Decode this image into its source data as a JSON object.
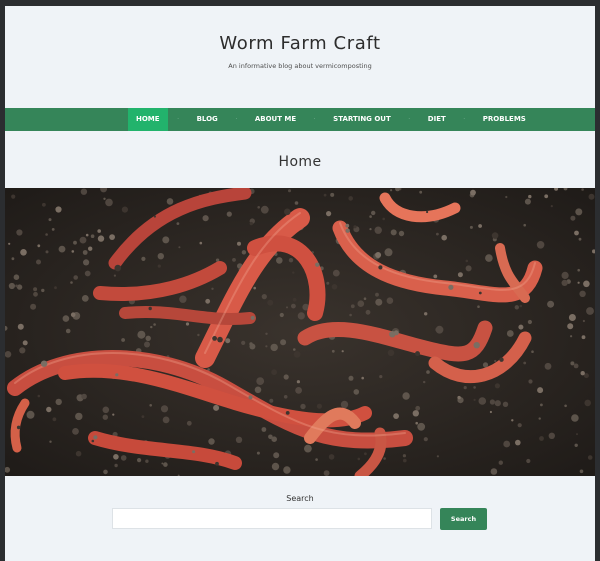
{
  "site": {
    "title": "Worm Farm Craft",
    "tagline": "An informative blog about vermicomposting"
  },
  "nav": {
    "items": [
      {
        "label": "HOME",
        "active": true
      },
      {
        "label": "BLOG",
        "active": false
      },
      {
        "label": "ABOUT ME",
        "active": false
      },
      {
        "label": "STARTING OUT",
        "active": false
      },
      {
        "label": "DIET",
        "active": false
      },
      {
        "label": "PROBLEMS",
        "active": false
      }
    ],
    "separator": "·"
  },
  "page": {
    "title": "Home",
    "hero_image": "earthworms-in-soil"
  },
  "search": {
    "label": "Search",
    "value": "",
    "placeholder": "",
    "button_label": "Search"
  },
  "colors": {
    "nav_bg": "#358559",
    "nav_active": "#22b36c",
    "page_bg": "#eff3f7",
    "button_bg": "#358559"
  }
}
